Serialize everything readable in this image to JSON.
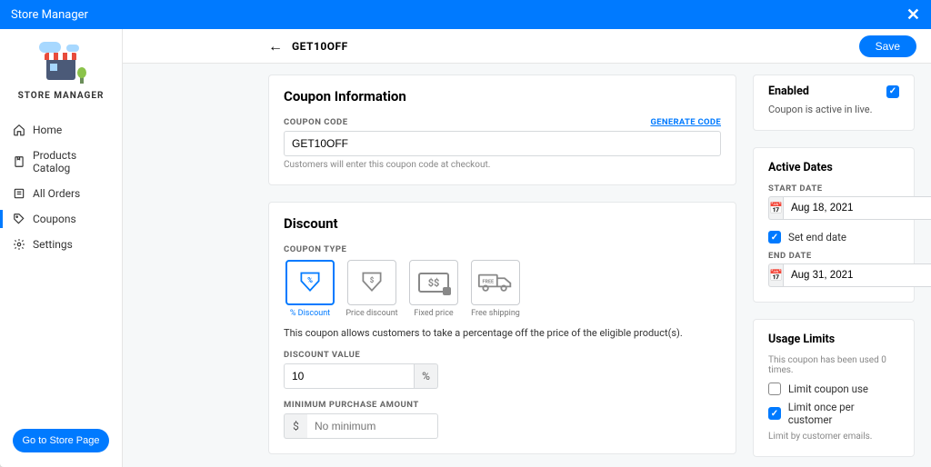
{
  "titlebar": {
    "title": "Store Manager"
  },
  "sidebar": {
    "brand": "STORE MANAGER",
    "items": [
      {
        "label": "Home",
        "icon": "home"
      },
      {
        "label": "Products Catalog",
        "icon": "products"
      },
      {
        "label": "All Orders",
        "icon": "orders"
      },
      {
        "label": "Coupons",
        "icon": "coupons"
      },
      {
        "label": "Settings",
        "icon": "settings"
      }
    ],
    "cta": "Go to Store Page"
  },
  "topbar": {
    "title": "GET10OFF",
    "save": "Save"
  },
  "coupon_info": {
    "heading": "Coupon Information",
    "code_label": "COUPON CODE",
    "generate": "GENERATE CODE",
    "code_value": "GET10OFF",
    "hint": "Customers will enter this coupon code at checkout."
  },
  "discount": {
    "heading": "Discount",
    "type_label": "COUPON TYPE",
    "types": [
      {
        "label": "% Discount"
      },
      {
        "label": "Price discount"
      },
      {
        "label": "Fixed price"
      },
      {
        "label": "Free shipping"
      }
    ],
    "selected_index": 0,
    "description": "This coupon allows customers to take a percentage off the price of the eligible product(s).",
    "value_label": "DISCOUNT VALUE",
    "value": "10",
    "value_suffix": "%",
    "min_label": "MINIMUM PURCHASE AMOUNT",
    "min_prefix": "$",
    "min_placeholder": "No minimum"
  },
  "enabled": {
    "heading": "Enabled",
    "status": "Coupon is active in live."
  },
  "dates": {
    "heading": "Active Dates",
    "start_label": "START DATE",
    "start": "Aug 18, 2021",
    "set_end": "Set end date",
    "end_label": "END DATE",
    "end": "Aug 31, 2021"
  },
  "usage": {
    "heading": "Usage Limits",
    "info": "This coupon has been used 0 times.",
    "limit_use": "Limit coupon use",
    "limit_once": "Limit once per customer",
    "hint": "Limit by customer emails."
  }
}
